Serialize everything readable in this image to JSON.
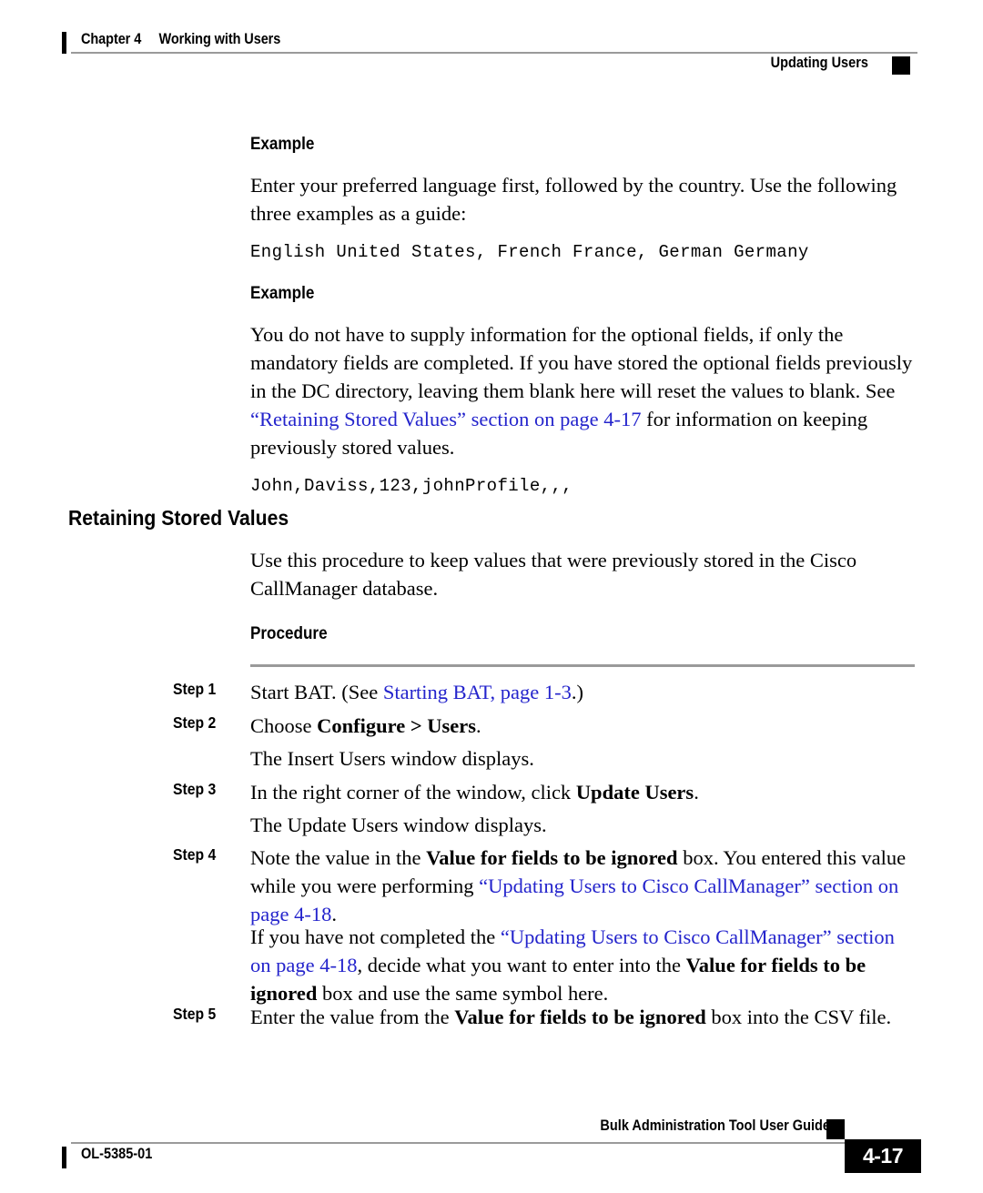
{
  "header": {
    "chapter": "Chapter 4",
    "chapter_title": "Working with Users",
    "section_right": "Updating Users"
  },
  "example1": {
    "heading": "Example",
    "paragraph": "Enter your preferred language first, followed by the country. Use the following three examples as a guide:",
    "code": "English United States, French France, German Germany"
  },
  "example2": {
    "heading": "Example",
    "para_part1": "You do not have to supply information for the optional fields, if only the mandatory fields are completed. If you have stored the optional fields previously in the DC directory, leaving them blank here will reset the values to blank. See ",
    "link": "“Retaining Stored Values” section on page 4-17",
    "para_part2": " for information on keeping previously stored values.",
    "code": "John,Daviss,123,johnProfile,,,"
  },
  "section": {
    "heading": "Retaining Stored Values",
    "intro": "Use this procedure to keep values that were previously stored in the Cisco CallManager database.",
    "procedure_heading": "Procedure"
  },
  "steps": [
    {
      "label": "Step 1",
      "text_before": "Start BAT. (See ",
      "link": "Starting BAT, page 1-3",
      "text_after": ".)"
    },
    {
      "label": "Step 2",
      "text_before": "Choose ",
      "bold": "Configure > Users",
      "text_after": ".",
      "continuation": "The Insert Users window displays."
    },
    {
      "label": "Step 3",
      "text_before": "In the right corner of the window, click ",
      "bold": "Update Users",
      "text_after": ".",
      "continuation": "The Update Users window displays."
    },
    {
      "label": "Step 4",
      "p1_a": "Note the value in the ",
      "p1_bold": "Value for fields to be ignored",
      "p1_b": " box. You entered this value while you were performing ",
      "p1_link": "“Updating Users to Cisco CallManager” section on page 4-18",
      "p1_c": ".",
      "p2_a": "If you have not completed the ",
      "p2_link": "“Updating Users to Cisco CallManager” section on page 4-18",
      "p2_b": ", decide what you want to enter into the ",
      "p2_bold": "Value for fields to be ignored",
      "p2_c": " box and use the same symbol here."
    },
    {
      "label": "Step 5",
      "text_before": "Enter the value from the ",
      "bold": "Value for fields to be ignored",
      "text_after": " box into the CSV file."
    }
  ],
  "footer": {
    "guide_title": "Bulk Administration Tool User Guide",
    "doc_id": "OL-5385-01",
    "page_number": "4-17"
  },
  "colors": {
    "link": "#2424cc",
    "rule": "#9a9a9a",
    "text": "#000000"
  }
}
